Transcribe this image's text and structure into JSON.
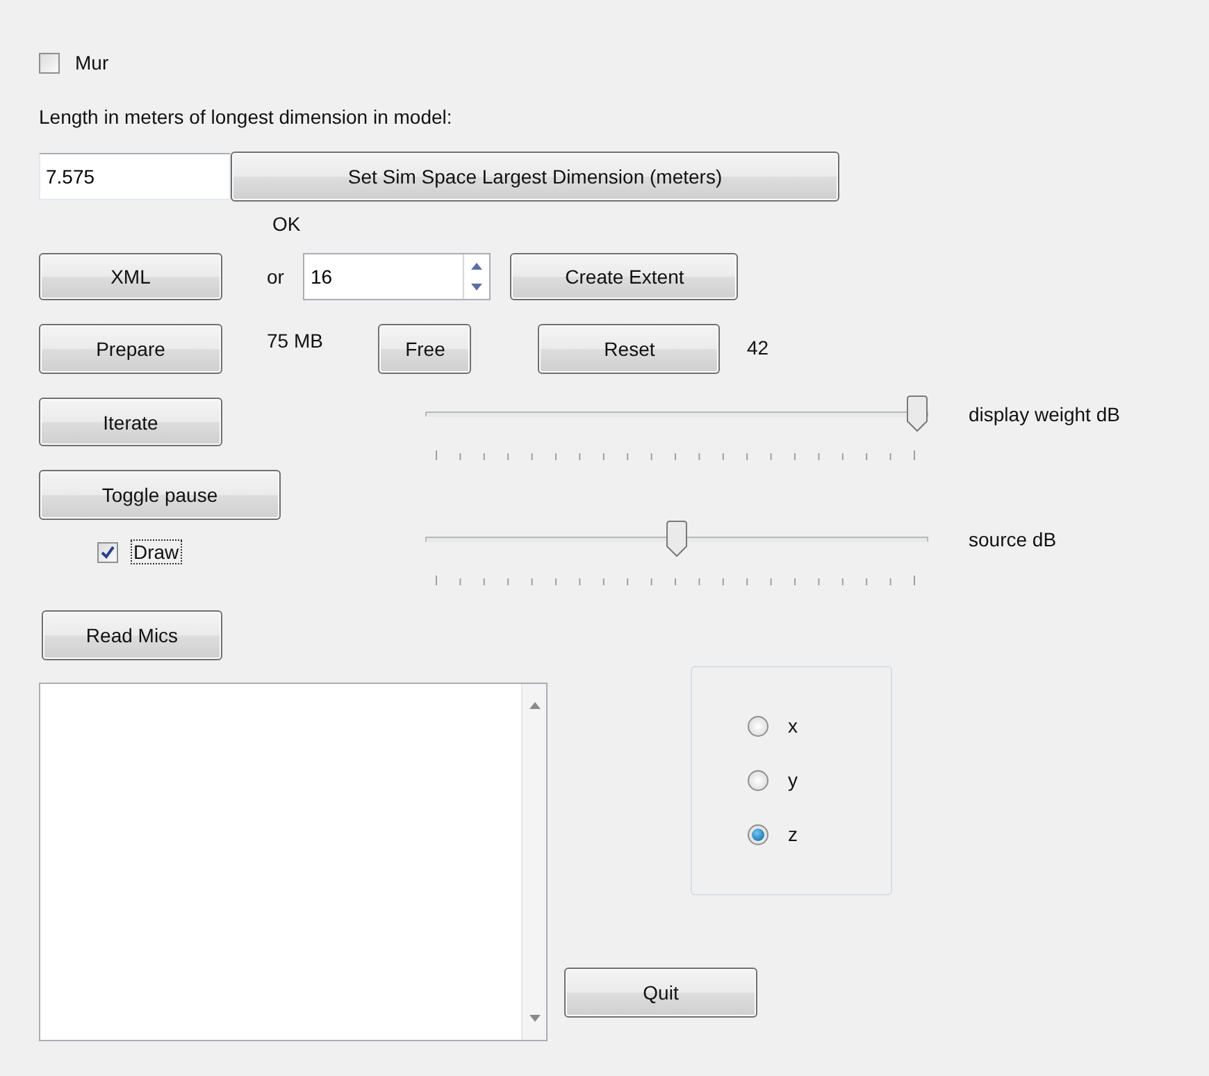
{
  "mur": {
    "label": "Mur",
    "checked": false
  },
  "length_label": "Length in meters of longest dimension in model:",
  "length_field": {
    "value": "7.575"
  },
  "set_button": "Set Sim Space Largest Dimension (meters)",
  "status": "OK",
  "xml_button": "XML",
  "or_label": "or",
  "extent_field": {
    "value": "16"
  },
  "create_extent_button": "Create Extent",
  "prepare_button": "Prepare",
  "memory": "75 MB",
  "free_button": "Free",
  "reset_button": "Reset",
  "counter": "42",
  "iterate_button": "Iterate",
  "toggle_pause_button": "Toggle pause",
  "draw": {
    "label": "Draw",
    "checked": true
  },
  "sliders": [
    {
      "label": "display weight dB",
      "level": 1.0
    },
    {
      "label": "source dB",
      "level": 0.5
    }
  ],
  "read_mics_button": "Read Mics",
  "axis_options": [
    {
      "label": "x",
      "selected": false
    },
    {
      "label": "y",
      "selected": false
    },
    {
      "label": "z",
      "selected": true
    }
  ],
  "quit_button": "Quit"
}
